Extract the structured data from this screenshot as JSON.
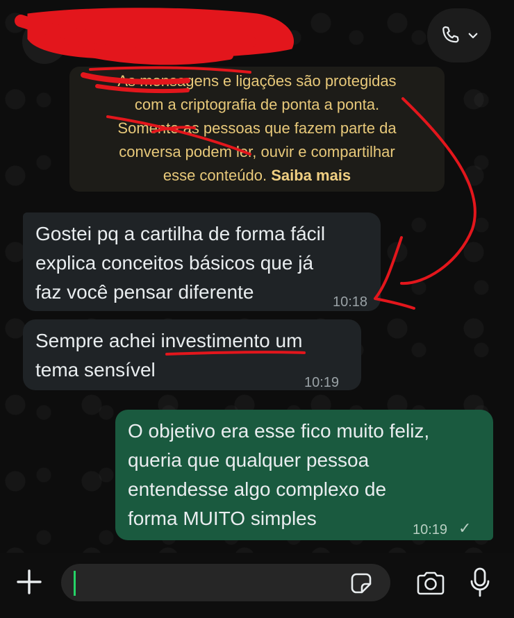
{
  "system_notice": {
    "lines": [
      "As mensagens e ligações são protegidas",
      "com a criptografia de ponta a ponta.",
      "Somente as pessoas que fazem parte da",
      "conversa podem ler, ouvir e compartilhar",
      "esse conteúdo."
    ],
    "link": "Saiba mais"
  },
  "messages": [
    {
      "direction": "incoming",
      "lines": [
        "Gostei pq a cartilha de forma fácil",
        "explica conceitos básicos que já",
        "faz você pensar diferente"
      ],
      "time": "10:18"
    },
    {
      "direction": "incoming",
      "lines_a": "Sempre achei ",
      "lines_b": "investimento",
      "lines_c": " um",
      "line2": "tema sensível",
      "time": "10:19"
    },
    {
      "direction": "outgoing",
      "lines": [
        "O objetivo era esse fico muito feliz,",
        "queria que qualquer pessoa",
        "entendesse algo complexo de",
        "forma MUITO simples"
      ],
      "time": "10:19",
      "status": "✓"
    }
  ],
  "icons": {
    "call": "phone-icon",
    "chevron": "chevron-down-icon",
    "plus": "plus-icon",
    "sticker": "sticker-icon",
    "camera": "camera-icon",
    "mic": "microphone-icon"
  },
  "colors": {
    "incoming_bubble": "#1f2326",
    "outgoing_bubble": "#1a5a3f",
    "system_text": "#e8c97a",
    "annotation": "#e3161c",
    "cursor": "#25d366"
  }
}
